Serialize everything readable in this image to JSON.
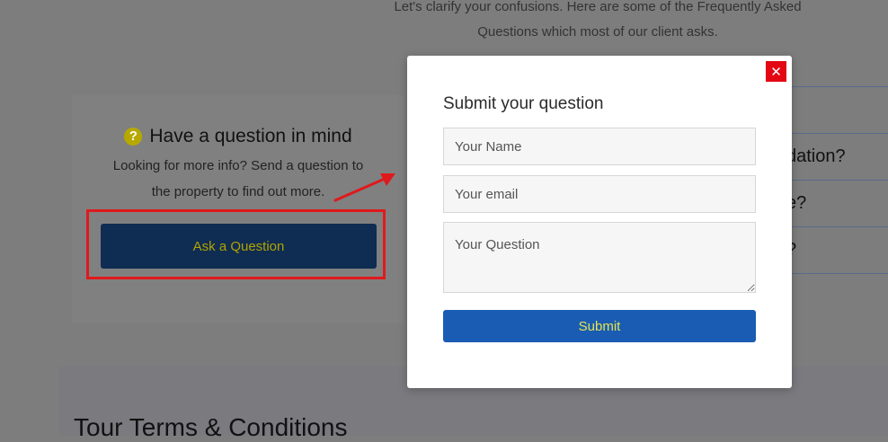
{
  "faq": {
    "intro_line1": "Let's clarify your confusions. Here are some of the Frequently Asked",
    "intro_line2": "Questions which most of our client asks.",
    "items_partial": [
      "",
      "dation?",
      "e?",
      "?"
    ]
  },
  "ask_card": {
    "title": "Have a question in mind",
    "subtitle_line1": "Looking for more info? Send a question to",
    "subtitle_line2": "the property to find out more.",
    "button_label": "Ask a Question",
    "help_icon_glyph": "?"
  },
  "terms": {
    "title": "Tour Terms & Conditions"
  },
  "modal": {
    "title": "Submit your question",
    "close_glyph": "✕",
    "name_placeholder": "Your Name",
    "email_placeholder": "Your email",
    "question_placeholder": "Your Question",
    "submit_label": "Submit"
  },
  "colors": {
    "overlay": "#7d7d7d",
    "highlight_border": "#e0191c",
    "close_bg": "#e30613",
    "submit_bg": "#1a5cb3",
    "submit_text": "#e4e34d",
    "ask_button_bg": "#0f2c52"
  },
  "icons": [
    "help-circle-icon",
    "close-icon",
    "annotation-arrow-icon"
  ]
}
